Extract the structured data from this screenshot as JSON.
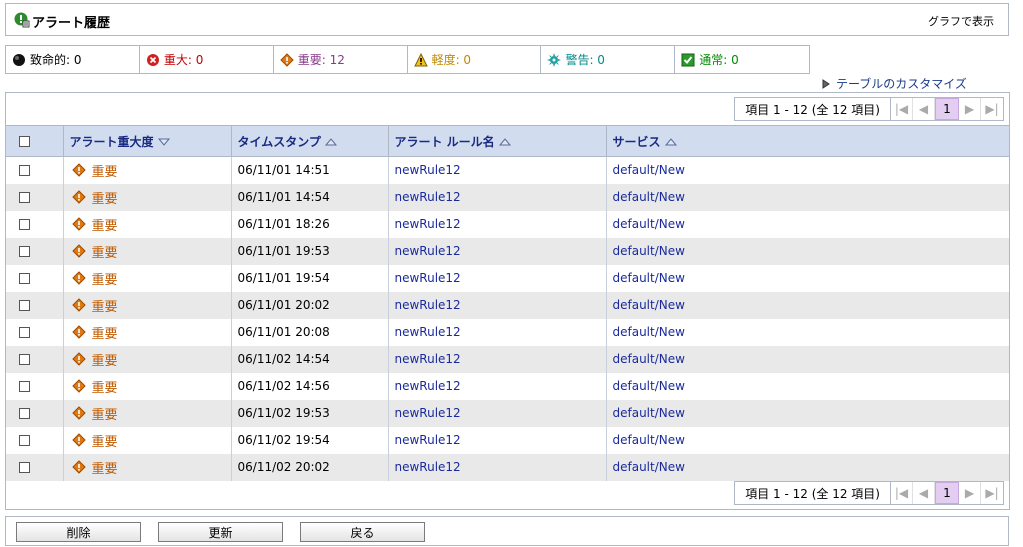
{
  "header": {
    "title": "アラート履歴",
    "graph_link": "グラフで表示"
  },
  "severity_summary": [
    {
      "key": "fatal",
      "label": "致命的: 0",
      "color": "#000000",
      "icon": "fatal-circle-icon"
    },
    {
      "key": "critical",
      "label": "重大: 0",
      "color": "#c00000",
      "icon": "critical-x-icon"
    },
    {
      "key": "major",
      "label": "重要: 12",
      "color": "#8a3a8a",
      "icon": "major-diamond-icon"
    },
    {
      "key": "minor",
      "label": "軽度: 0",
      "color": "#c08a00",
      "icon": "minor-warning-icon"
    },
    {
      "key": "warning",
      "label": "警告: 0",
      "color": "#008a8a",
      "icon": "warning-gear-icon"
    },
    {
      "key": "normal",
      "label": "通常: 0",
      "color": "#008a00",
      "icon": "normal-check-icon"
    }
  ],
  "customize_link": "テーブルのカスタマイズ",
  "pager": {
    "info": "項目 1 - 12 (全 12 項目)",
    "current_page": "1"
  },
  "table": {
    "columns": [
      "アラート重大度",
      "タイムスタンプ",
      "アラート ルール名",
      "サービス"
    ],
    "rows": [
      {
        "severity": "重要",
        "timestamp": "06/11/01 14:51",
        "rule": "newRule12",
        "service": "default/New"
      },
      {
        "severity": "重要",
        "timestamp": "06/11/01 14:54",
        "rule": "newRule12",
        "service": "default/New"
      },
      {
        "severity": "重要",
        "timestamp": "06/11/01 18:26",
        "rule": "newRule12",
        "service": "default/New"
      },
      {
        "severity": "重要",
        "timestamp": "06/11/01 19:53",
        "rule": "newRule12",
        "service": "default/New"
      },
      {
        "severity": "重要",
        "timestamp": "06/11/01 19:54",
        "rule": "newRule12",
        "service": "default/New"
      },
      {
        "severity": "重要",
        "timestamp": "06/11/01 20:02",
        "rule": "newRule12",
        "service": "default/New"
      },
      {
        "severity": "重要",
        "timestamp": "06/11/01 20:08",
        "rule": "newRule12",
        "service": "default/New"
      },
      {
        "severity": "重要",
        "timestamp": "06/11/02 14:54",
        "rule": "newRule12",
        "service": "default/New"
      },
      {
        "severity": "重要",
        "timestamp": "06/11/02 14:56",
        "rule": "newRule12",
        "service": "default/New"
      },
      {
        "severity": "重要",
        "timestamp": "06/11/02 19:53",
        "rule": "newRule12",
        "service": "default/New"
      },
      {
        "severity": "重要",
        "timestamp": "06/11/02 19:54",
        "rule": "newRule12",
        "service": "default/New"
      },
      {
        "severity": "重要",
        "timestamp": "06/11/02 20:02",
        "rule": "newRule12",
        "service": "default/New"
      }
    ]
  },
  "buttons": {
    "delete": "削除",
    "refresh": "更新",
    "back": "戻る"
  },
  "colors": {
    "header_bg": "#d1ddef",
    "alt_row_bg": "#e9e9e9",
    "link": "#1a2a9c",
    "severity_major": "#c05a00",
    "pager_active": "#e3cdf0"
  }
}
